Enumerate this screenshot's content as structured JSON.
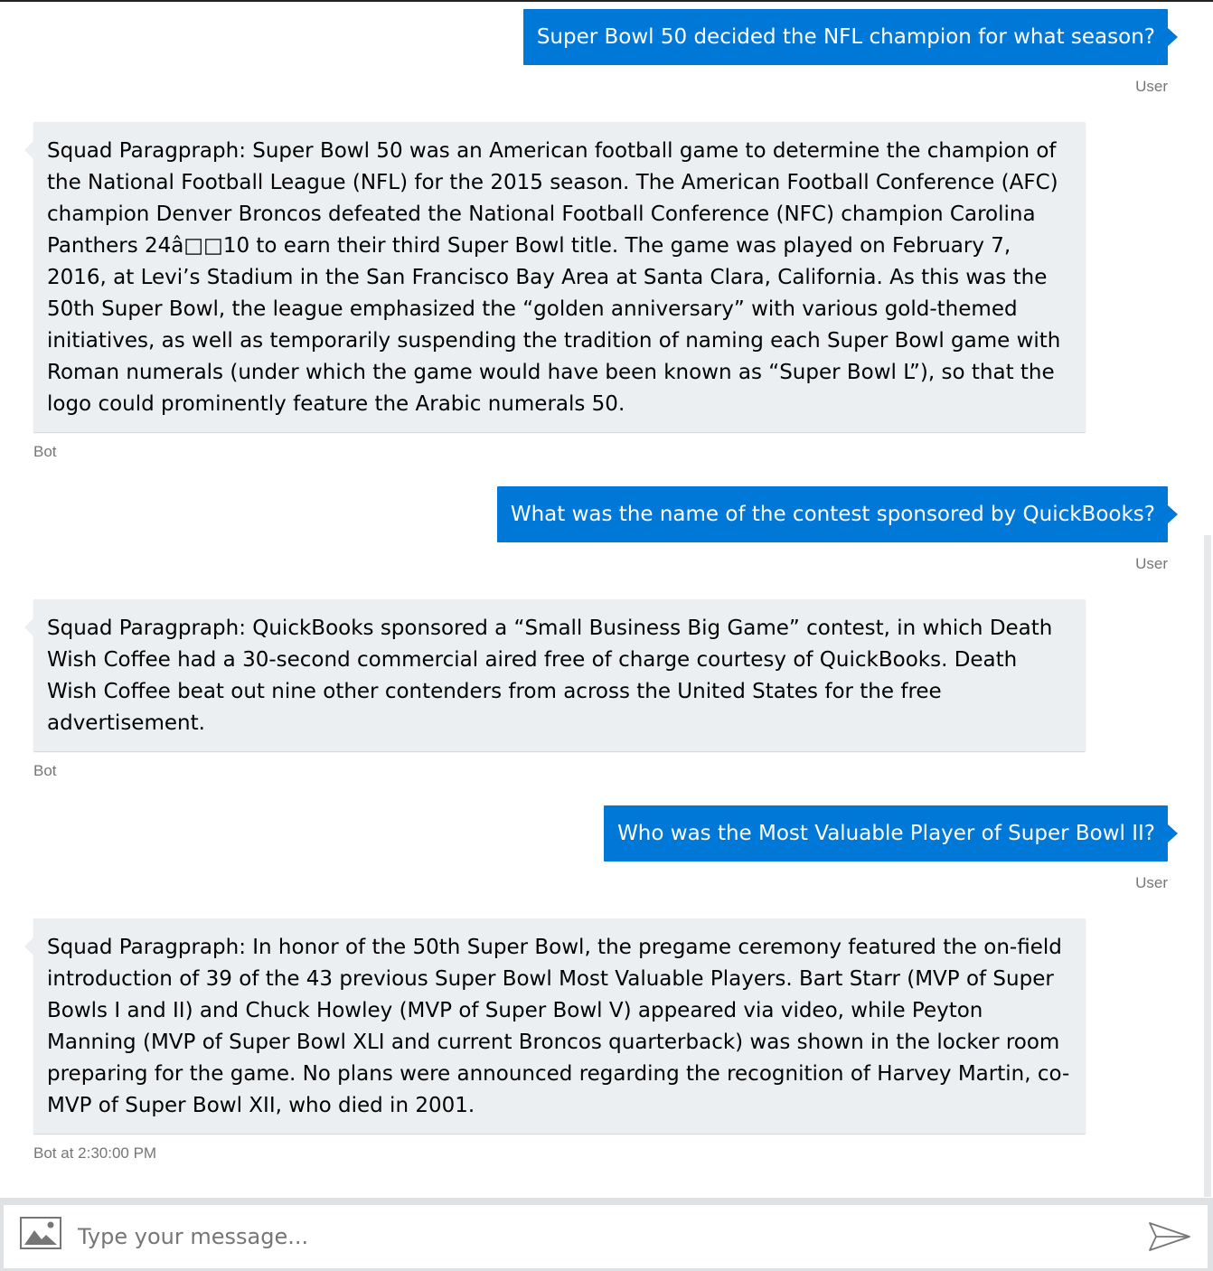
{
  "conversation": {
    "messages": [
      {
        "from": "user",
        "text": "Super Bowl 50 decided the NFL champion for what season?",
        "label": "User"
      },
      {
        "from": "bot",
        "text": "Squad Paragpraph: Super Bowl 50 was an American football game to determine the champion of the National Football League (NFL) for the 2015 season. The American Football Conference (AFC) champion Denver Broncos defeated the National Football Conference (NFC) champion Carolina Panthers 24â□□10 to earn their third Super Bowl title. The game was played on February 7, 2016, at Levi’s Stadium in the San Francisco Bay Area at Santa Clara, California. As this was the 50th Super Bowl, the league emphasized the “golden anniversary” with various gold-themed initiatives, as well as temporarily suspending the tradition of naming each Super Bowl game with Roman numerals (under which the game would have been known as “Super Bowl L”), so that the logo could prominently feature the Arabic numerals 50.",
        "label": "Bot"
      },
      {
        "from": "user",
        "text": "What was the name of the contest sponsored by QuickBooks?",
        "label": "User"
      },
      {
        "from": "bot",
        "text": "Squad Paragpraph: QuickBooks sponsored a “Small Business Big Game” contest, in which Death Wish Coffee had a 30-second commercial aired free of charge courtesy of QuickBooks. Death Wish Coffee beat out nine other contenders from across the United States for the free advertisement.",
        "label": "Bot"
      },
      {
        "from": "user",
        "text": "Who was the Most Valuable Player of Super Bowl II?",
        "label": "User"
      },
      {
        "from": "bot",
        "text": "Squad Paragpraph: In honor of the 50th Super Bowl, the pregame ceremony featured the on-field introduction of 39 of the 43 previous Super Bowl Most Valuable Players. Bart Starr (MVP of Super Bowls I and II) and Chuck Howley (MVP of Super Bowl V) appeared via video, while Peyton Manning (MVP of Super Bowl XLI and current Broncos quarterback) was shown in the locker room preparing for the game. No plans were announced regarding the recognition of Harvey Martin, co-MVP of Super Bowl XII, who died in 2001.",
        "label": "Bot at 2:30:00 PM"
      }
    ]
  },
  "composer": {
    "placeholder": "Type your message...",
    "upload_icon": "image-upload-icon",
    "send_icon": "send-icon"
  },
  "colors": {
    "user_bubble": "#0078d7",
    "bot_bubble": "#eceff1",
    "label_text": "#767676"
  }
}
